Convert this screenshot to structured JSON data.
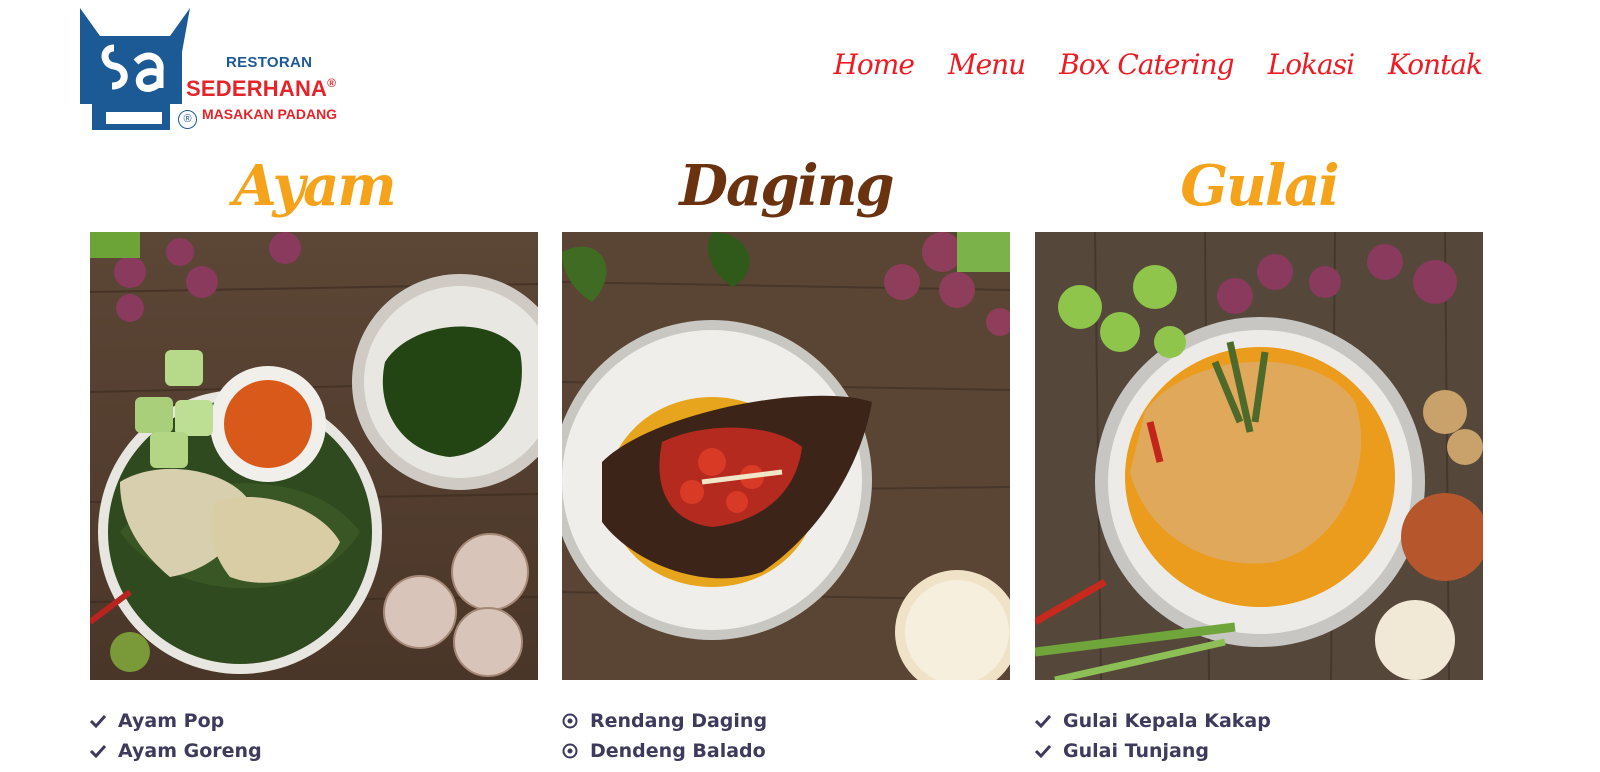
{
  "brand": {
    "line1": "RESTORAN",
    "line2": "SEDERHANA",
    "line3": "MASAKAN PADANG",
    "mark_letters": "Sa",
    "reg": "®",
    "colors": {
      "blue": "#1c5a96",
      "red": "#e3252b"
    }
  },
  "nav": {
    "items": [
      {
        "label": "Home"
      },
      {
        "label": "Menu"
      },
      {
        "label": "Box Catering"
      },
      {
        "label": "Lokasi"
      },
      {
        "label": "Kontak"
      }
    ],
    "color": "#ed1c24"
  },
  "columns": [
    {
      "title": "Ayam",
      "title_color": "#f5a31a",
      "image": "ayam-dish-photo",
      "list_icon": "check-icon",
      "items": [
        "Ayam Pop",
        "Ayam Goreng"
      ]
    },
    {
      "title": "Daging",
      "title_color": "#6b3210",
      "image": "daging-dish-photo",
      "list_icon": "dot-circle-icon",
      "items": [
        "Rendang Daging",
        "Dendeng Balado"
      ]
    },
    {
      "title": "Gulai",
      "title_color": "#f5a31a",
      "image": "gulai-dish-photo",
      "list_icon": "check-icon",
      "items": [
        "Gulai Kepala Kakap",
        "Gulai Tunjang"
      ]
    }
  ]
}
